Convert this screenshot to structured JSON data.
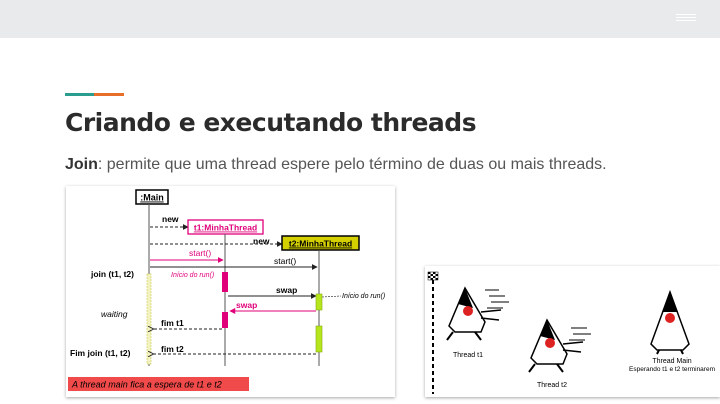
{
  "header": {
    "menu_icon": "hamburger-icon"
  },
  "slide": {
    "title": "Criando e executando threads",
    "subtitle_bold": "Join",
    "subtitle_rest": ": permite que uma thread espere pelo término de duas ou mais threads."
  },
  "diagram": {
    "main_label": ":Main",
    "new1": "new",
    "t1_label": "t1:MinhaThread",
    "new2": "new",
    "t2_label": "t2:MinhaThread",
    "start1": "start()",
    "start2": "start()",
    "join_label": "join (t1, t2)",
    "inicio1": "Início do run()",
    "swap1": "swap",
    "inicio2": "Início do run()",
    "waiting": "waiting",
    "swap2": "swap",
    "fim_t1": "fim t1",
    "fim_join": "Fim join (t1, t2)",
    "fim_t2": "fim t2",
    "caption": "A thread main fica a espera de t1 e t2"
  },
  "race": {
    "thread_t1": "Thread t1",
    "thread_t2": "Thread t2",
    "thread_main": "Thread Main",
    "waiting_text": "Esperando t1 e t2 terminarem"
  },
  "colors": {
    "accent_teal": "#2a9d8f",
    "accent_orange": "#e76f2a",
    "magenta": "#e0007a",
    "lime": "#b5e61d",
    "t2_box": "#d4d000",
    "caption_bg": "#f04a4a"
  }
}
